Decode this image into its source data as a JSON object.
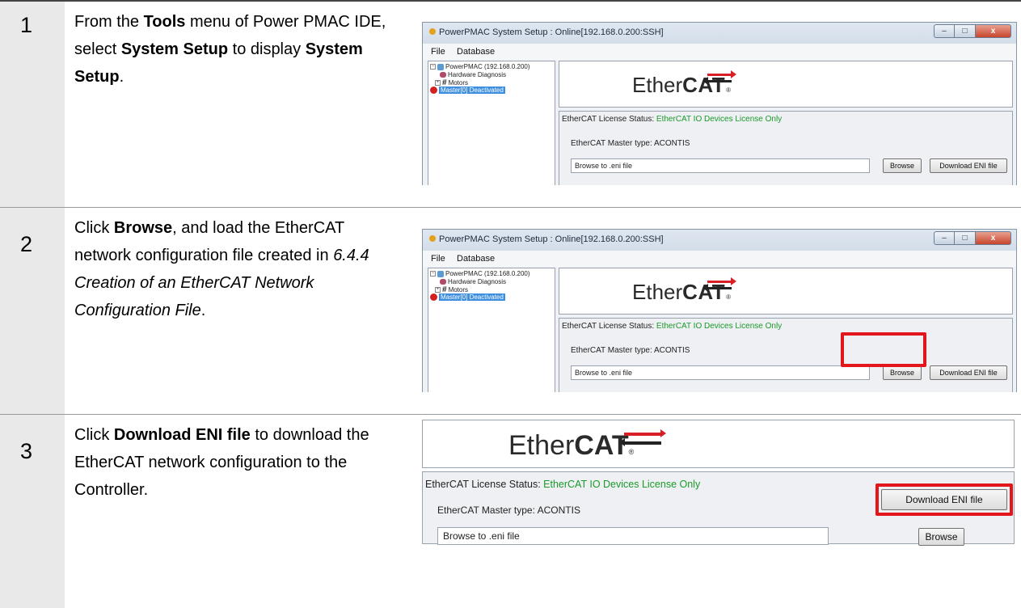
{
  "steps": [
    {
      "number": "1"
    },
    {
      "number": "2"
    },
    {
      "number": "3"
    }
  ],
  "text": {
    "s1": [
      "From the ",
      "Tools",
      " menu of Power PMAC IDE, select ",
      "System Setup",
      " to display ",
      "System Setup",
      "."
    ],
    "s2": [
      "Click ",
      "Browse",
      ", and load the EtherCAT network configuration file created in ",
      "6.4.4 Creation of an EtherCAT Network Configuration File",
      "."
    ],
    "s3": [
      "Click ",
      "Download ENI file",
      " to download the EtherCAT network configuration to the Controller."
    ]
  },
  "window": {
    "title": "PowerPMAC System Setup  : Online[192.168.0.200:SSH]",
    "menu": [
      "File",
      "Database"
    ],
    "tree": [
      "PowerPMAC (192.168.0.200)",
      "Hardware Diagnosis",
      "Motors",
      "Master[0] Deactivated"
    ],
    "controls": {
      "minimize": "–",
      "maximize": "□",
      "close": "x"
    }
  },
  "ethercat": {
    "logo_ether": "Ether",
    "logo_cat": "CAT",
    "logo_reg": "®",
    "license_label": "EtherCAT License Status:",
    "license_value": "EtherCAT IO Devices License Only",
    "master_type": "EtherCAT Master type:  ACONTIS",
    "eni_placeholder": "Browse to .eni file",
    "browse_button": "Browse",
    "download_button": "Download ENI file"
  },
  "colors": {
    "highlight": "#e3161c",
    "license_value": "#1a9a2a",
    "step_column": "#e9e9e9"
  }
}
